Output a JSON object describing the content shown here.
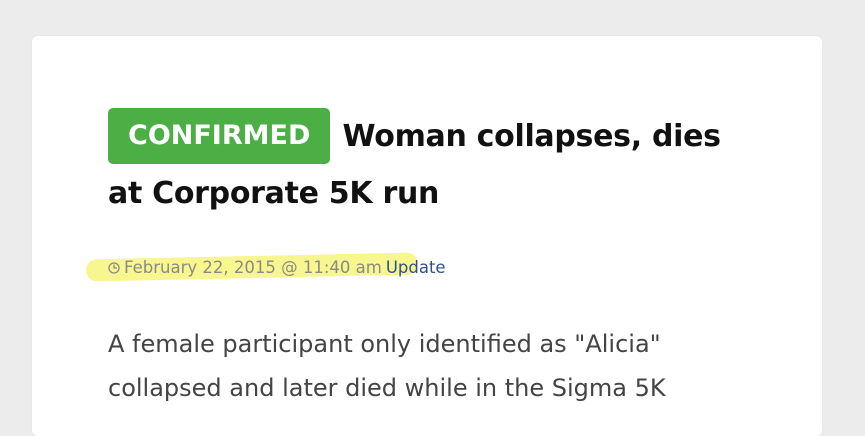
{
  "article": {
    "badge": "CONFIRMED",
    "headline": "Woman collapses, dies at Corporate 5K run",
    "date": "February 22, 2015 @ 11:40 am",
    "update_label": "Update",
    "body_line1": "A female participant only identified as \"Alicia\"",
    "body_line2": "collapsed and later died while in the Sigma 5K"
  },
  "colors": {
    "badge_bg": "#4caf46",
    "highlight": "#f7f57a",
    "link": "#2f4f8f"
  },
  "icons": {
    "date": "clock-icon"
  }
}
